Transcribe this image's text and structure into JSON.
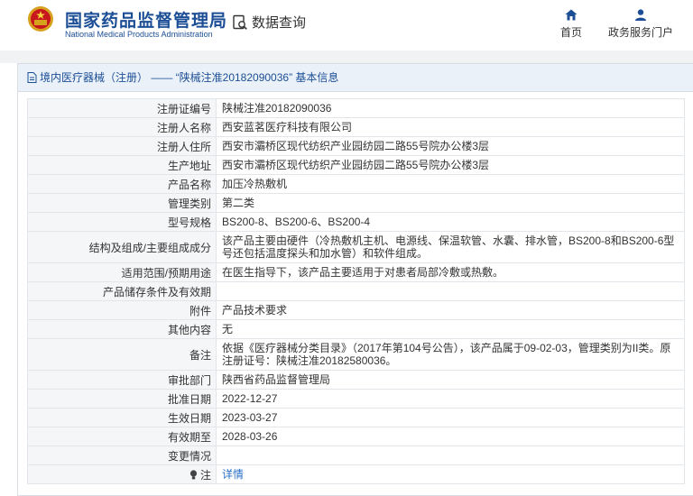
{
  "header": {
    "org_cn": "国家药品监督管理局",
    "org_en": "National Medical Products Administration",
    "db_query": "数据查询",
    "nav": [
      {
        "label": "首页",
        "icon": "home-icon"
      },
      {
        "label": "政务服务门户",
        "icon": "user-icon"
      }
    ]
  },
  "panel": {
    "title": "境内医疗器械（注册） —— “陕械注准20182090036” 基本信息"
  },
  "rows": [
    {
      "key": "注册证编号",
      "value": "陕械注准20182090036"
    },
    {
      "key": "注册人名称",
      "value": "西安蓝茗医疗科技有限公司"
    },
    {
      "key": "注册人住所",
      "value": "西安市灞桥区现代纺织产业园纺园二路55号院办公楼3层"
    },
    {
      "key": "生产地址",
      "value": "西安市灞桥区现代纺织产业园纺园二路55号院办公楼3层"
    },
    {
      "key": "产品名称",
      "value": "加压冷热敷机"
    },
    {
      "key": "管理类别",
      "value": "第二类"
    },
    {
      "key": "型号规格",
      "value": "BS200-8、BS200-6、BS200-4"
    },
    {
      "key": "结构及组成/主要组成成分",
      "value": "该产品主要由硬件（冷热敷机主机、电源线、保温软管、水囊、排水管，BS200-8和BS200-6型号还包括温度探头和加水管）和软件组成。"
    },
    {
      "key": "适用范围/预期用途",
      "value": "在医生指导下，该产品主要适用于对患者局部冷敷或热敷。"
    },
    {
      "key": "产品储存条件及有效期",
      "value": ""
    },
    {
      "key": "附件",
      "value": "产品技术要求"
    },
    {
      "key": "其他内容",
      "value": "无"
    },
    {
      "key": "备注",
      "value": "依据《医疗器械分类目录》（2017年第104号公告），该产品属于09-02-03，管理类别为II类。原注册证号：陕械注准20182580036。"
    },
    {
      "key": "审批部门",
      "value": "陕西省药品监督管理局"
    },
    {
      "key": "批准日期",
      "value": "2022-12-27"
    },
    {
      "key": "生效日期",
      "value": "2023-03-27"
    },
    {
      "key": "有效期至",
      "value": "2028-03-26"
    },
    {
      "key": "变更情况",
      "value": ""
    }
  ],
  "note": {
    "key": "注",
    "link": "详情",
    "icon": "bulb-icon"
  },
  "colors": {
    "brand": "#1c4e96",
    "link": "#2a6fc9",
    "title_bg": "#eaf1f9",
    "key_bg": "#f5f6f8"
  }
}
